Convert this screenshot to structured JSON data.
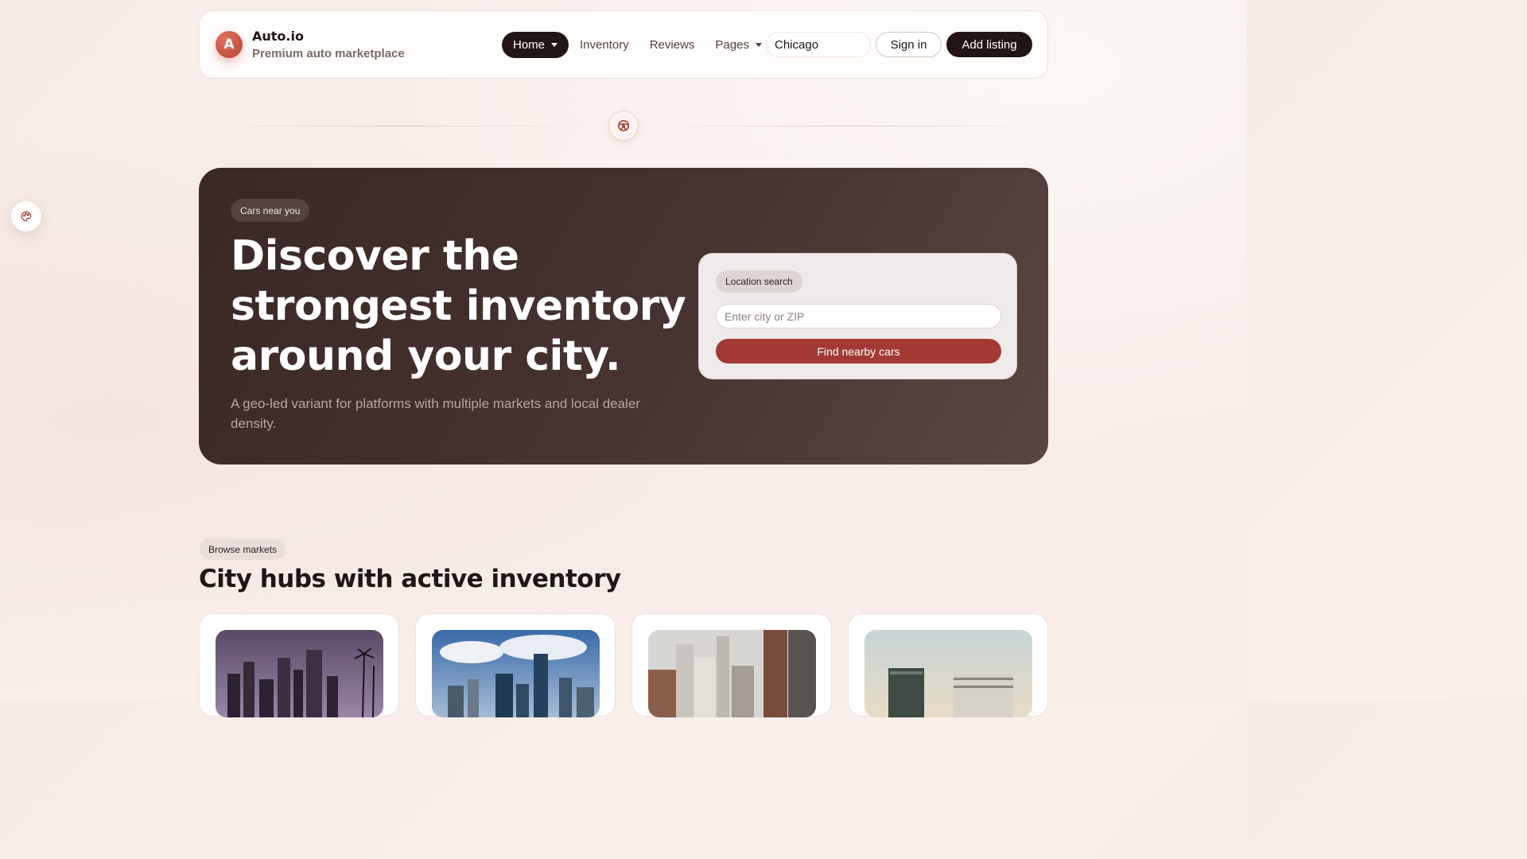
{
  "brand": {
    "logo_letter": "A",
    "name": "Auto.io",
    "tagline": "Premium auto marketplace"
  },
  "nav": {
    "home": "Home",
    "inventory": "Inventory",
    "reviews": "Reviews",
    "pages": "Pages",
    "city_value": "Chicago",
    "sign_in": "Sign in",
    "add_listing": "Add listing"
  },
  "hero": {
    "badge": "Cars near you",
    "title": "Discover the strongest inventory around your city.",
    "subtitle": "A geo-led variant for platforms with multiple markets and local dealer density.",
    "search": {
      "badge": "Location search",
      "placeholder": "Enter city or ZIP",
      "button": "Find nearby cars"
    }
  },
  "markets": {
    "badge": "Browse markets",
    "title": "City hubs with active inventory"
  },
  "colors": {
    "accent": "#a23a33",
    "dark": "#221614",
    "hero_bg": "#3f2c29"
  },
  "icons": {
    "divider": "steering-wheel-icon",
    "floating": "palette-icon"
  }
}
